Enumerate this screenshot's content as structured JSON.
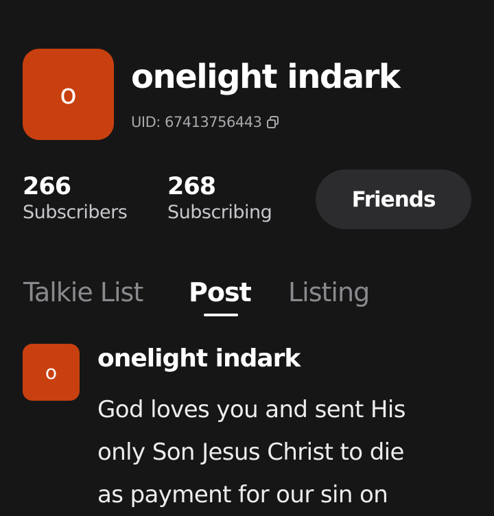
{
  "profile": {
    "avatar_letter": "o",
    "avatar_color": "#c8400f",
    "name": "onelight indark",
    "uid": "UID: 67413756443",
    "copy_icon": "copy-icon"
  },
  "stats": [
    {
      "value": "266",
      "label": "Subscribers"
    },
    {
      "value": "268",
      "label": "Subscribing"
    }
  ],
  "friends_button": {
    "label": "Friends"
  },
  "tabs": [
    {
      "label": "Talkie List",
      "active": false
    },
    {
      "label": "Post",
      "active": true
    },
    {
      "label": "Listing",
      "active": false
    }
  ],
  "post": {
    "avatar_letter": "o",
    "author": "onelight indark",
    "lines": [
      "God loves you and sent His",
      "only Son Jesus Christ to die",
      "as payment for our sin on"
    ]
  },
  "colors": {
    "background": "#161617",
    "accent": "#c8400f",
    "button_bg": "#2c2c2f",
    "muted_text": "#8a8a8e"
  }
}
